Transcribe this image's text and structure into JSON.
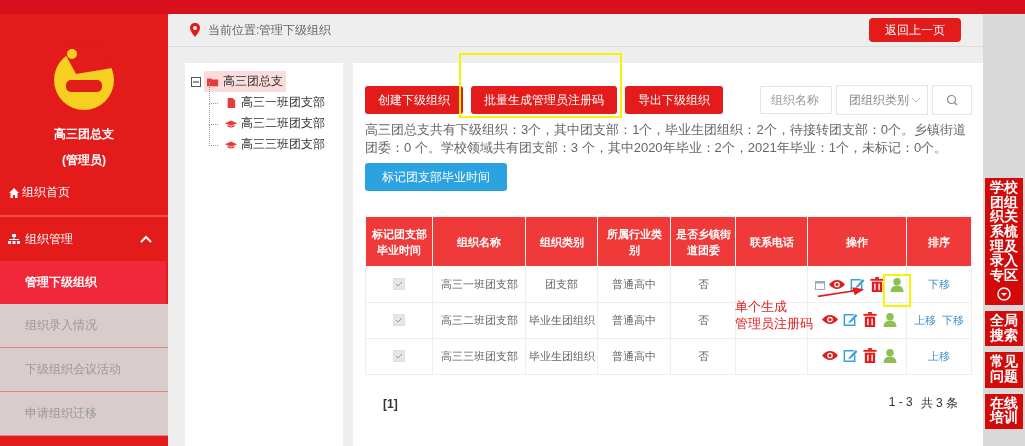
{
  "sidebar": {
    "org_name": "高三团总支",
    "role": "(管理员)",
    "home": "组织首页",
    "section": {
      "label": "组织管理",
      "expanded": true
    },
    "items": [
      {
        "label": "管理下级组织",
        "selected": true
      },
      {
        "label": "组织录入情况",
        "selected": false
      },
      {
        "label": "下级组织会议活动",
        "selected": false
      },
      {
        "label": "申请组织迁移",
        "selected": false
      }
    ]
  },
  "breadcrumb": "当前位置:管理下级组织",
  "back_button": "返回上一页",
  "tree": {
    "label": "高三团总支",
    "expanded": true,
    "selected": true,
    "children": [
      {
        "label": "高三一班团支部",
        "kind": "file"
      },
      {
        "label": "高三二班团支部",
        "kind": "cap"
      },
      {
        "label": "高三三班团支部",
        "kind": "cap"
      }
    ]
  },
  "toolbar": {
    "buttons": [
      "创建下级组织",
      "批量生成管理员注册码",
      "导出下级组织"
    ],
    "name_placeholder": "组织名称",
    "type_placeholder": "团组织类别"
  },
  "summary": "高三团总支共有下级组织：3个，其中团支部：1个，毕业生团组织：2个，待接转团支部：0个。乡镇街道团委：0 个。学校领域共有团支部：3 个，其中2020年毕业：2个，2021年毕业：1个，未标记：0个。",
  "mark_button": "标记团支部毕业时间",
  "table": {
    "columns": [
      "标记团支部毕业时间",
      "组织名称",
      "组织类别",
      "所属行业类别",
      "是否乡镇街道团委",
      "联系电话",
      "操作",
      "排序"
    ],
    "rows": [
      {
        "marked": true,
        "name": "高三一班团支部",
        "type": "团支部",
        "industry": "普通高中",
        "township": "否",
        "actions": [
          {
            "kind": "calendar"
          },
          {
            "kind": "view"
          },
          {
            "kind": "edit"
          },
          {
            "kind": "delete"
          },
          {
            "kind": "user"
          }
        ],
        "sort": [
          "下移"
        ]
      },
      {
        "marked": true,
        "name": "高三二班团支部",
        "type": "毕业生团组织",
        "industry": "普通高中",
        "township": "否",
        "actions": [
          {
            "kind": "view"
          },
          {
            "kind": "edit"
          },
          {
            "kind": "delete"
          },
          {
            "kind": "user"
          }
        ],
        "sort": [
          "上移",
          "下移"
        ]
      },
      {
        "marked": true,
        "name": "高三三班团支部",
        "type": "毕业生团组织",
        "industry": "普通高中",
        "township": "否",
        "actions": [
          {
            "kind": "view"
          },
          {
            "kind": "edit"
          },
          {
            "kind": "delete"
          },
          {
            "kind": "user"
          }
        ],
        "sort": [
          "上移"
        ]
      }
    ]
  },
  "pagination": {
    "pages": "[1]",
    "range": "1 - 3",
    "total": "共 3 条"
  },
  "annotation": {
    "lines": [
      "单个生成",
      "管理员注册码"
    ]
  },
  "rail": [
    {
      "label": "学校团组织关系梳理及录入专区",
      "kind": "expand"
    },
    {
      "label": "全局搜索",
      "kind": "plain"
    },
    {
      "label": "常见问题",
      "kind": "plain"
    },
    {
      "label": "在线培训",
      "kind": "plain"
    }
  ]
}
